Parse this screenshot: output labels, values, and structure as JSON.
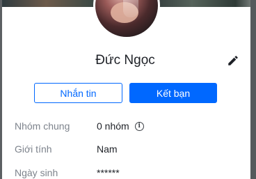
{
  "profile": {
    "name": "Đức Ngọc"
  },
  "actions": {
    "message_label": "Nhắn tin",
    "add_friend_label": "Kết bạn"
  },
  "info": {
    "groups_label": "Nhóm chung",
    "groups_value": "0 nhóm",
    "gender_label": "Giới tính",
    "gender_value": "Nam",
    "dob_label": "Ngày sinh",
    "dob_value": "******"
  },
  "icons": {
    "edit": "pencil-icon",
    "info": "info-icon"
  },
  "colors": {
    "accent": "#0068ff",
    "label": "#7d838c",
    "text": "#1e2127"
  }
}
